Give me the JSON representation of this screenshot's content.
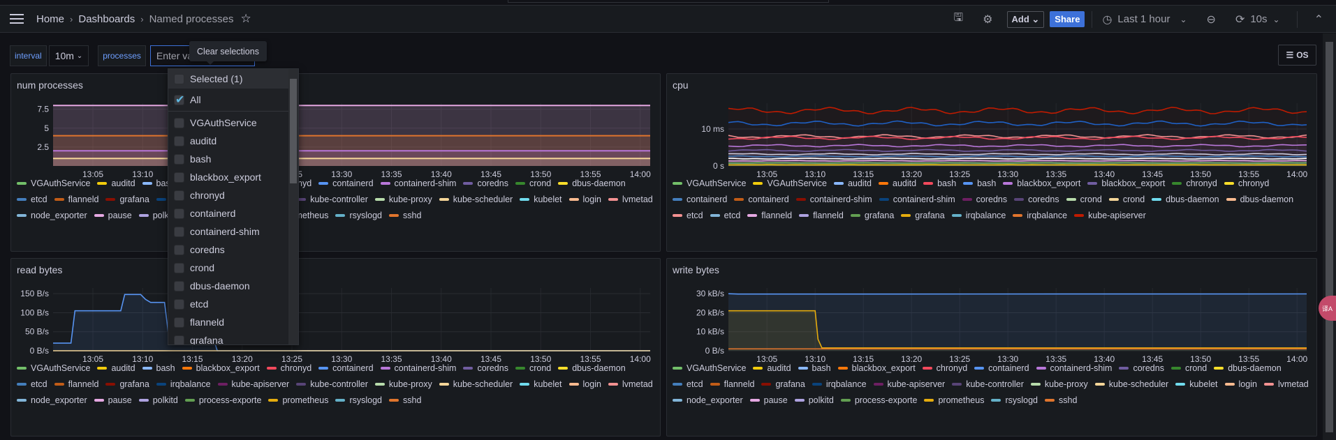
{
  "header": {
    "breadcrumb": [
      "Home",
      "Dashboards",
      "Named processes"
    ],
    "add_label": "Add",
    "share_label": "Share",
    "time_range": "Last 1 hour",
    "refresh": "10s",
    "share_color": "#3d71d9"
  },
  "variables": {
    "interval_label": "interval",
    "interval_value": "10m",
    "processes_label": "processes",
    "processes_placeholder": "Enter variable value",
    "os_button": "OS"
  },
  "tooltip": "Clear selections",
  "dropdown": {
    "selected": "Selected (1)",
    "all": "All",
    "items": [
      "VGAuthService",
      "auditd",
      "bash",
      "blackbox_export",
      "chronyd",
      "containerd",
      "containerd-shim",
      "coredns",
      "crond",
      "dbus-daemon",
      "etcd",
      "flanneld",
      "grafana"
    ]
  },
  "time_ticks": [
    "13:05",
    "13:10",
    "13:15",
    "13:20",
    "13:25",
    "13:30",
    "13:35",
    "13:40",
    "13:45",
    "13:50",
    "13:55",
    "14:00"
  ],
  "panels": {
    "num_processes": {
      "title": "num processes",
      "legend": [
        [
          "VGAuthService",
          "#73bf69"
        ],
        [
          "auditd",
          "#f2cc0c"
        ],
        [
          "bash",
          "#8ab8ff"
        ],
        [
          "blackbox_export",
          "#ff780a"
        ],
        [
          "chronyd",
          "#f2495c"
        ],
        [
          "containerd",
          "#5794f2"
        ],
        [
          "containerd-shim",
          "#b877d9"
        ],
        [
          "coredns",
          "#705da0"
        ],
        [
          "crond",
          "#37872d"
        ],
        [
          "dbus-daemon",
          "#fade2a"
        ],
        [
          "etcd",
          "#447ebc"
        ],
        [
          "flanneld",
          "#c15c17"
        ],
        [
          "grafana",
          "#890f02"
        ],
        [
          "irqbalance",
          "#0a437c"
        ],
        [
          "kube-apiserver",
          "#6d1f62"
        ],
        [
          "kube-controller",
          "#584477"
        ],
        [
          "kube-proxy",
          "#b7dbab"
        ],
        [
          "kube-scheduler",
          "#f4d598"
        ],
        [
          "kubelet",
          "#70dbed"
        ],
        [
          "login",
          "#f9ba8f"
        ],
        [
          "lvmetad",
          "#f29191"
        ],
        [
          "node_exporter",
          "#82b5d8"
        ],
        [
          "pause",
          "#e5a8e2"
        ],
        [
          "polkitd",
          "#aea2e0"
        ],
        [
          "process-exporte",
          "#629e51"
        ],
        [
          "prometheus",
          "#e5ac0e"
        ],
        [
          "rsyslogd",
          "#64b0c8"
        ],
        [
          "sshd",
          "#e0752d"
        ]
      ]
    },
    "cpu": {
      "title": "cpu",
      "legend": [
        [
          "VGAuthService",
          "#73bf69"
        ],
        [
          "VGAuthService",
          "#f2cc0c"
        ],
        [
          "auditd",
          "#8ab8ff"
        ],
        [
          "auditd",
          "#ff780a"
        ],
        [
          "bash",
          "#f2495c"
        ],
        [
          "bash",
          "#5794f2"
        ],
        [
          "blackbox_export",
          "#b877d9"
        ],
        [
          "blackbox_export",
          "#705da0"
        ],
        [
          "chronyd",
          "#37872d"
        ],
        [
          "chronyd",
          "#fade2a"
        ],
        [
          "containerd",
          "#447ebc"
        ],
        [
          "containerd",
          "#c15c17"
        ],
        [
          "containerd-shim",
          "#890f02"
        ],
        [
          "containerd-shim",
          "#0a437c"
        ],
        [
          "coredns",
          "#6d1f62"
        ],
        [
          "coredns",
          "#584477"
        ],
        [
          "crond",
          "#b7dbab"
        ],
        [
          "crond",
          "#f4d598"
        ],
        [
          "dbus-daemon",
          "#70dbed"
        ],
        [
          "dbus-daemon",
          "#f9ba8f"
        ],
        [
          "etcd",
          "#f29191"
        ],
        [
          "etcd",
          "#82b5d8"
        ],
        [
          "flanneld",
          "#e5a8e2"
        ],
        [
          "flanneld",
          "#aea2e0"
        ],
        [
          "grafana",
          "#629e51"
        ],
        [
          "grafana",
          "#e5ac0e"
        ],
        [
          "irqbalance",
          "#64b0c8"
        ],
        [
          "irqbalance",
          "#e0752d"
        ],
        [
          "kube-apiserver",
          "#bf1b00"
        ]
      ]
    },
    "read_bytes": {
      "title": "read bytes"
    },
    "write_bytes": {
      "title": "write bytes"
    }
  },
  "chart_data": [
    {
      "type": "area",
      "title": "num processes",
      "x_unit": "minutes after 13:00",
      "xlim": [
        1,
        61
      ],
      "ylim": [
        0,
        8.3
      ],
      "yticks": [
        [
          "2.5",
          2.5
        ],
        [
          "5",
          5
        ],
        [
          "7.5",
          7.5
        ]
      ],
      "series": [
        {
          "color": "#e5a8e2",
          "points": [
            [
              1,
              8
            ],
            [
              61,
              8
            ]
          ]
        },
        {
          "color": "#e0752d",
          "points": [
            [
              1,
              4
            ],
            [
              61,
              4
            ]
          ]
        },
        {
          "color": "#b877d9",
          "points": [
            [
              1,
              2
            ],
            [
              61,
              2
            ]
          ]
        },
        {
          "color": "#f4d598",
          "points": [
            [
              1,
              1
            ],
            [
              61,
              1
            ]
          ]
        }
      ]
    },
    {
      "type": "line",
      "title": "cpu",
      "x_unit": "minutes after 13:00",
      "xlim": [
        1,
        61
      ],
      "ylim": [
        0,
        17
      ],
      "yticks": [
        [
          "0 s",
          0
        ],
        [
          "10 ms",
          10
        ]
      ],
      "series": [
        {
          "color": "#bf1b00",
          "base": 15
        },
        {
          "color": "#1f60c4",
          "base": 11.5
        },
        {
          "color": "#f29191",
          "base": 8
        },
        {
          "color": "#f2495c",
          "base": 7.6
        },
        {
          "color": "#b877d9",
          "base": 5.5
        },
        {
          "color": "#705da0",
          "base": 4.2
        },
        {
          "color": "#ccccdc",
          "base": 3.2
        },
        {
          "color": "#447ebc",
          "base": 2.6
        },
        {
          "color": "#ffffff",
          "base": 2
        },
        {
          "color": "#e5a8e2",
          "base": 1.4
        },
        {
          "color": "#73bf69",
          "base": 0.8
        },
        {
          "color": "#f2cc0c",
          "base": 0.3
        }
      ]
    },
    {
      "type": "line",
      "title": "read bytes",
      "x_unit": "minutes after 13:00",
      "xlim": [
        1,
        61
      ],
      "ylim": [
        0,
        165
      ],
      "yticks": [
        [
          "0 B/s",
          0
        ],
        [
          "50 B/s",
          50
        ],
        [
          "100 B/s",
          100
        ],
        [
          "150 B/s",
          150
        ]
      ],
      "series": [
        {
          "color": "#5794f2",
          "fill": true,
          "points": [
            [
              1,
              20
            ],
            [
              2.8,
              20
            ],
            [
              3.2,
              105
            ],
            [
              7.8,
              105
            ],
            [
              8.2,
              148
            ],
            [
              9.8,
              148
            ],
            [
              10.3,
              135
            ],
            [
              10.8,
              127
            ],
            [
              12.2,
              127
            ],
            [
              12.6,
              42
            ],
            [
              17,
              42
            ],
            [
              17.5,
              0
            ],
            [
              61,
              0
            ]
          ]
        },
        {
          "color": "#f4d598",
          "points": [
            [
              1,
              0
            ],
            [
              61,
              0
            ]
          ]
        }
      ]
    },
    {
      "type": "line",
      "title": "write bytes",
      "x_unit": "minutes after 13:00",
      "xlim": [
        1,
        61
      ],
      "ylim": [
        0,
        33
      ],
      "yticks": [
        [
          "0 B/s",
          0
        ],
        [
          "10 kB/s",
          10
        ],
        [
          "20 kB/s",
          20
        ],
        [
          "30 kB/s",
          30
        ]
      ],
      "series": [
        {
          "color": "#5794f2",
          "fill": true,
          "points": [
            [
              1,
              30
            ],
            [
              2,
              29.8
            ],
            [
              61,
              29.9
            ]
          ]
        },
        {
          "color": "#e5ac0e",
          "fill": true,
          "points": [
            [
              1,
              21
            ],
            [
              10,
              21
            ],
            [
              10.3,
              6
            ],
            [
              10.7,
              1.5
            ],
            [
              61,
              1.5
            ]
          ]
        },
        {
          "color": "#e0752d",
          "points": [
            [
              1,
              1
            ],
            [
              61,
              1
            ]
          ]
        }
      ]
    }
  ]
}
